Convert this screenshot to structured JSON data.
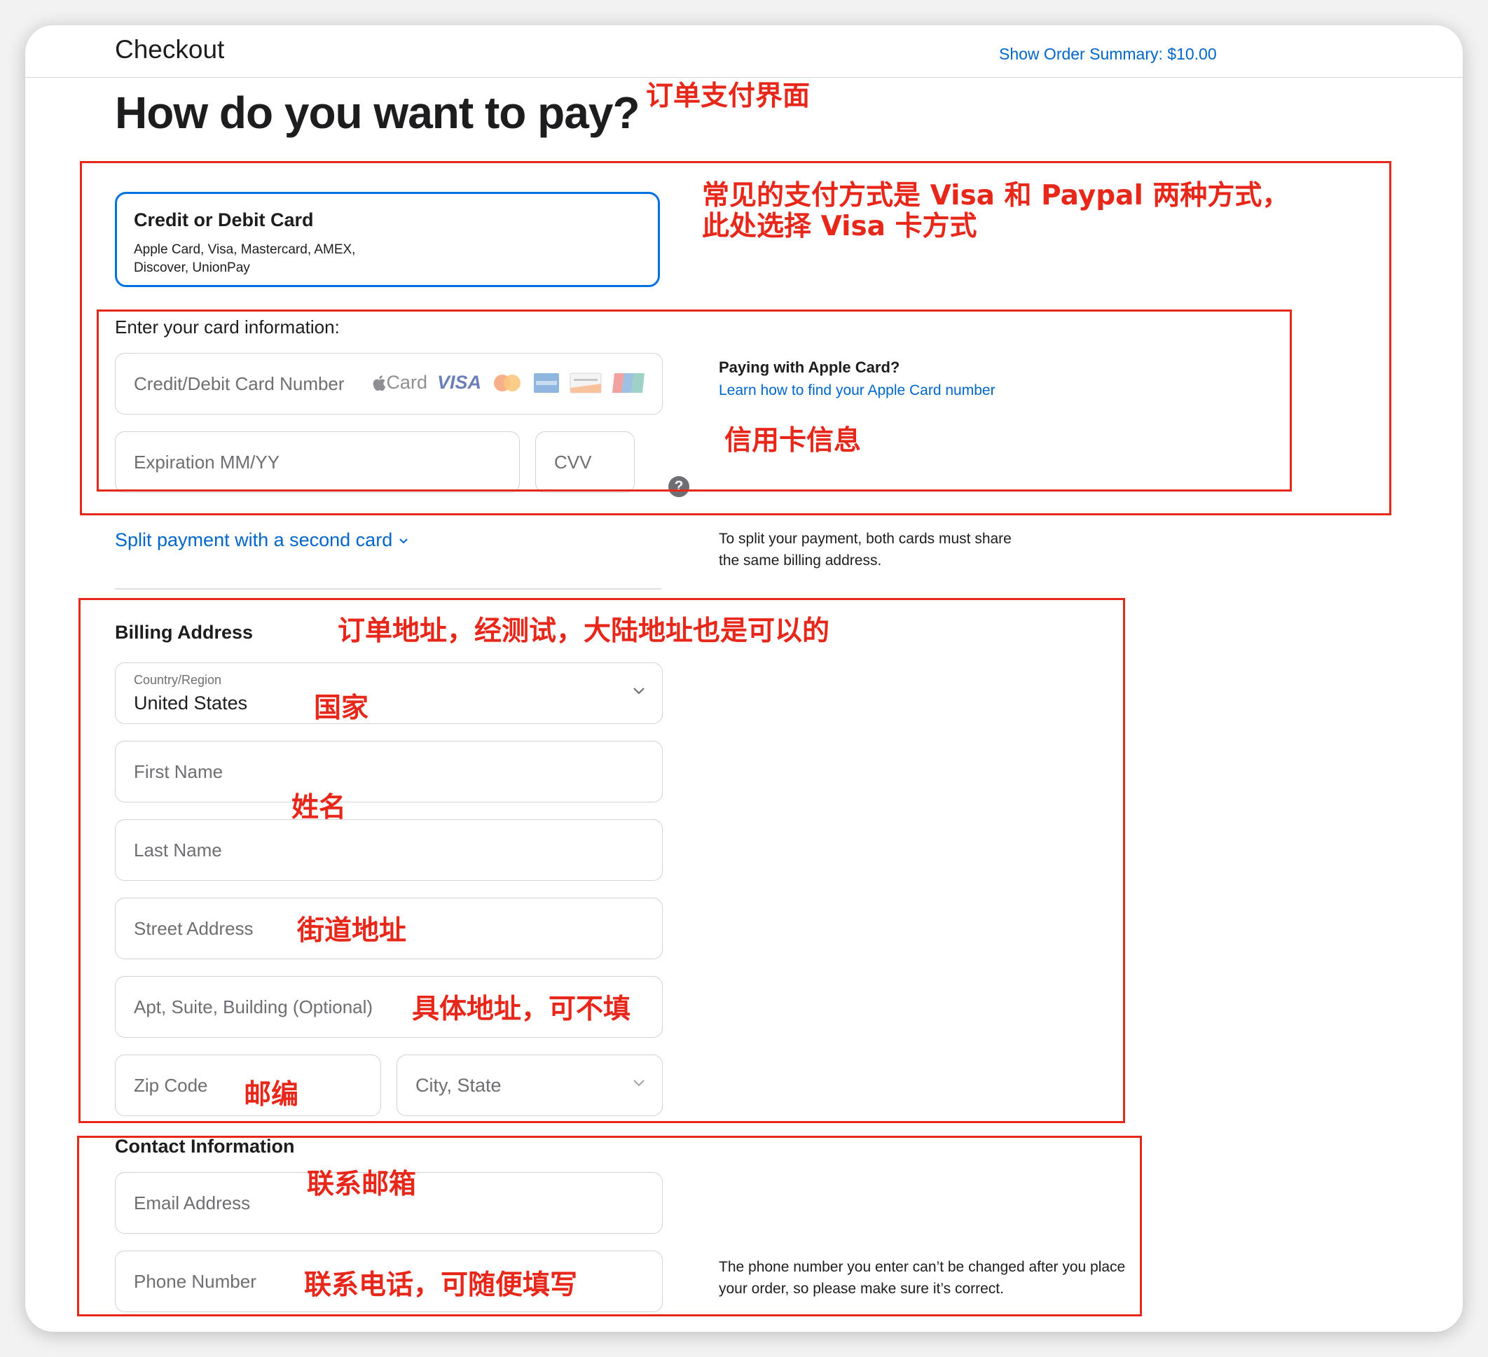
{
  "header": {
    "title": "Checkout",
    "order_summary": "Show Order Summary: $10.00"
  },
  "page_title": "How do you want to pay?",
  "payment_option": {
    "title": "Credit or Debit Card",
    "subtitle": "Apple Card, Visa, Mastercard, AMEX, Discover, UnionPay"
  },
  "card_info": {
    "label": "Enter your card information:",
    "card_number_placeholder": "Credit/Debit Card Number",
    "expiration_placeholder": "Expiration MM/YY",
    "cvv_placeholder": "CVV",
    "cvv_help": "?",
    "logos": {
      "apple_card": "Card",
      "visa": "VISA",
      "others": [
        "mastercard-logo",
        "amex-logo",
        "discover-logo",
        "unionpay-logo"
      ]
    },
    "apple_card_heading": "Paying with Apple Card?",
    "apple_card_link": "Learn how to find your Apple Card number"
  },
  "split": {
    "link": "Split payment with a second card",
    "note": "To split your payment, both cards must share the same billing address."
  },
  "billing": {
    "heading": "Billing Address",
    "country_caption": "Country/Region",
    "country_value": "United States",
    "first_name_placeholder": "First Name",
    "last_name_placeholder": "Last Name",
    "street_placeholder": "Street Address",
    "apt_placeholder": "Apt, Suite, Building (Optional)",
    "zip_placeholder": "Zip Code",
    "city_state_placeholder": "City, State"
  },
  "contact": {
    "heading": "Contact Information",
    "email_placeholder": "Email Address",
    "phone_placeholder": "Phone Number",
    "phone_note": "The phone number you enter can’t be changed after you place your order, so please make sure it’s correct."
  },
  "annotations": {
    "page": "订单支付界面",
    "payment_method_line1": "常见的支付方式是 Visa 和 Paypal 两种方式，",
    "payment_method_line2": "此处选择 Visa 卡方式",
    "card_info": "信用卡信息",
    "billing": "订单地址，经测试，大陆地址也是可以的",
    "country": "国家",
    "name": "姓名",
    "street": "街道地址",
    "apt": "具体地址，可不填",
    "zip": "邮编",
    "email": "联系邮箱",
    "phone": "联系电话，可随便填写"
  },
  "colors": {
    "accent": "#0071e3",
    "link": "#0066cc",
    "annotation_red": "#e8271b"
  }
}
